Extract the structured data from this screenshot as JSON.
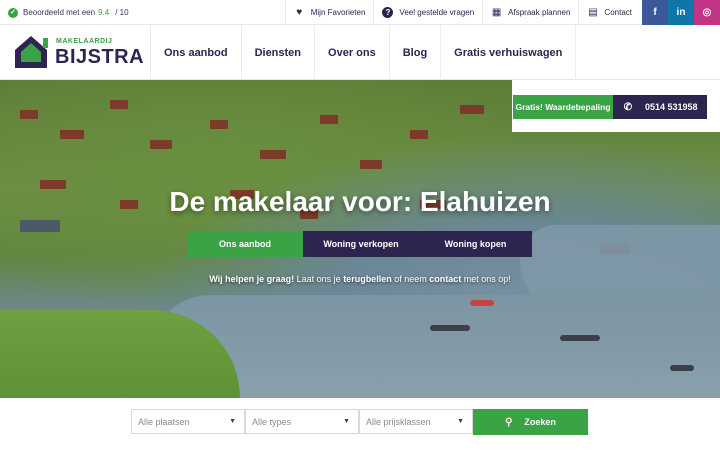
{
  "topbar": {
    "rating_prefix": "Beoordeeld met een",
    "rating_score": "9.4",
    "rating_scale": "/ 10",
    "links": [
      {
        "label": "Mijn Favorieten",
        "icon": "heart-icon"
      },
      {
        "label": "Veel gestelde vragen",
        "icon": "question-icon"
      },
      {
        "label": "Afspraak plannen",
        "icon": "calendar-icon"
      },
      {
        "label": "Contact",
        "icon": "chat-icon"
      }
    ],
    "social": [
      "f",
      "in",
      "◎"
    ]
  },
  "logo": {
    "small": "MAKELAARDIJ",
    "big": "BIJSTRA"
  },
  "nav": [
    {
      "label": "Ons aanbod"
    },
    {
      "label": "Diensten"
    },
    {
      "label": "Over ons"
    },
    {
      "label": "Blog"
    },
    {
      "label": "Gratis verhuiswagen"
    }
  ],
  "hero": {
    "waarde_button": "Gratis! Waardebepaling",
    "phone": "0514 531958",
    "title": "De makelaar voor: Elahuizen",
    "tabs": [
      "Ons aanbod",
      "Woning verkopen",
      "Woning kopen"
    ],
    "sub_1": "Wij helpen je graag!",
    "sub_2": " Laat ons je ",
    "sub_3": "terugbellen",
    "sub_4": " of neem ",
    "sub_5": "contact",
    "sub_6": " met ons op!"
  },
  "search": {
    "places": "Alle plaatsen",
    "types": "Alle types",
    "prices": "Alle prijsklassen",
    "button": "Zoeken"
  },
  "colors": {
    "green": "#3aa346",
    "navy": "#2d2450"
  }
}
